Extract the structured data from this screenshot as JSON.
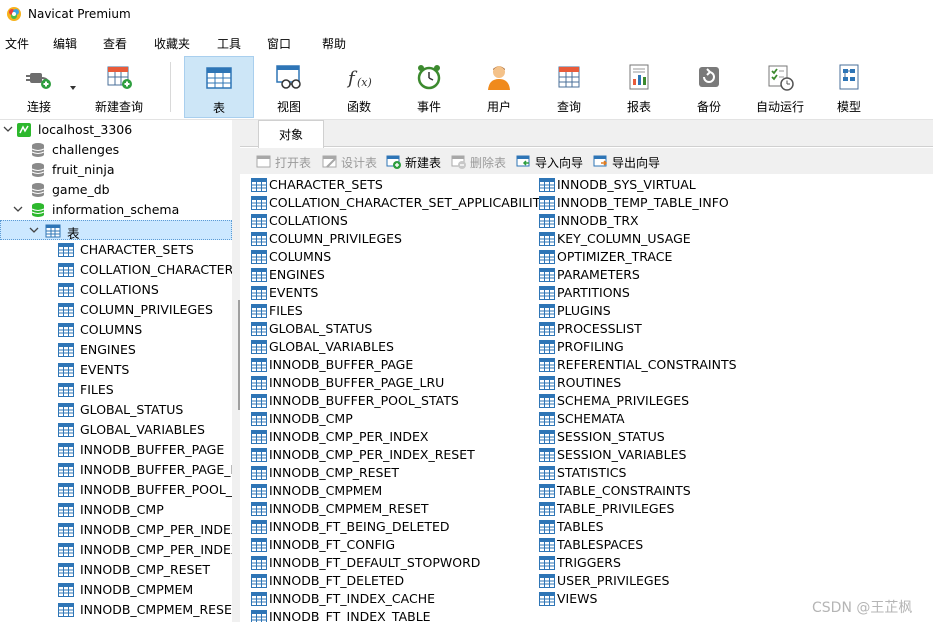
{
  "window": {
    "title": "Navicat Premium"
  },
  "menu": [
    "文件",
    "编辑",
    "查看",
    "收藏夹",
    "工具",
    "窗口",
    "帮助"
  ],
  "toolbar": {
    "connect": "连接",
    "new_query": "新建查询",
    "table": "表",
    "view": "视图",
    "function": "函数",
    "event": "事件",
    "user": "用户",
    "query": "查询",
    "report": "报表",
    "backup": "备份",
    "automation": "自动运行",
    "model": "模型"
  },
  "sidebar": {
    "connection": "localhost_3306",
    "databases": [
      "challenges",
      "fruit_ninja",
      "game_db",
      "information_schema"
    ],
    "tables_node": "表",
    "tables": [
      "CHARACTER_SETS",
      "COLLATION_CHARACTER_",
      "COLLATIONS",
      "COLUMN_PRIVILEGES",
      "COLUMNS",
      "ENGINES",
      "EVENTS",
      "FILES",
      "GLOBAL_STATUS",
      "GLOBAL_VARIABLES",
      "INNODB_BUFFER_PAGE",
      "INNODB_BUFFER_PAGE_LF",
      "INNODB_BUFFER_POOL_S",
      "INNODB_CMP",
      "INNODB_CMP_PER_INDEX",
      "INNODB_CMP_PER_INDEX",
      "INNODB_CMP_RESET",
      "INNODB_CMPMEM",
      "INNODB_CMPMEM_RESET"
    ]
  },
  "main": {
    "tab": "对象",
    "object_toolbar": {
      "open": "打开表",
      "design": "设计表",
      "new": "新建表",
      "delete": "删除表",
      "import": "导入向导",
      "export": "导出向导"
    },
    "tables_col1": [
      "CHARACTER_SETS",
      "COLLATION_CHARACTER_SET_APPLICABILITY",
      "COLLATIONS",
      "COLUMN_PRIVILEGES",
      "COLUMNS",
      "ENGINES",
      "EVENTS",
      "FILES",
      "GLOBAL_STATUS",
      "GLOBAL_VARIABLES",
      "INNODB_BUFFER_PAGE",
      "INNODB_BUFFER_PAGE_LRU",
      "INNODB_BUFFER_POOL_STATS",
      "INNODB_CMP",
      "INNODB_CMP_PER_INDEX",
      "INNODB_CMP_PER_INDEX_RESET",
      "INNODB_CMP_RESET",
      "INNODB_CMPMEM",
      "INNODB_CMPMEM_RESET",
      "INNODB_FT_BEING_DELETED",
      "INNODB_FT_CONFIG",
      "INNODB_FT_DEFAULT_STOPWORD",
      "INNODB_FT_DELETED",
      "INNODB_FT_INDEX_CACHE",
      "INNODB_FT_INDEX_TABLE"
    ],
    "tables_col2": [
      "INNODB_SYS_VIRTUAL",
      "INNODB_TEMP_TABLE_INFO",
      "INNODB_TRX",
      "KEY_COLUMN_USAGE",
      "OPTIMIZER_TRACE",
      "PARAMETERS",
      "PARTITIONS",
      "PLUGINS",
      "PROCESSLIST",
      "PROFILING",
      "REFERENTIAL_CONSTRAINTS",
      "ROUTINES",
      "SCHEMA_PRIVILEGES",
      "SCHEMATA",
      "SESSION_STATUS",
      "SESSION_VARIABLES",
      "STATISTICS",
      "TABLE_CONSTRAINTS",
      "TABLE_PRIVILEGES",
      "TABLES",
      "TABLESPACES",
      "TRIGGERS",
      "USER_PRIVILEGES",
      "VIEWS"
    ]
  },
  "watermark": "CSDN @王芷枫",
  "colors": {
    "selected_bg": "#cce8ff",
    "active_tool_bg": "#cde6f7",
    "table_icon": "#2e75b6",
    "db_icon": "#2db82d"
  }
}
